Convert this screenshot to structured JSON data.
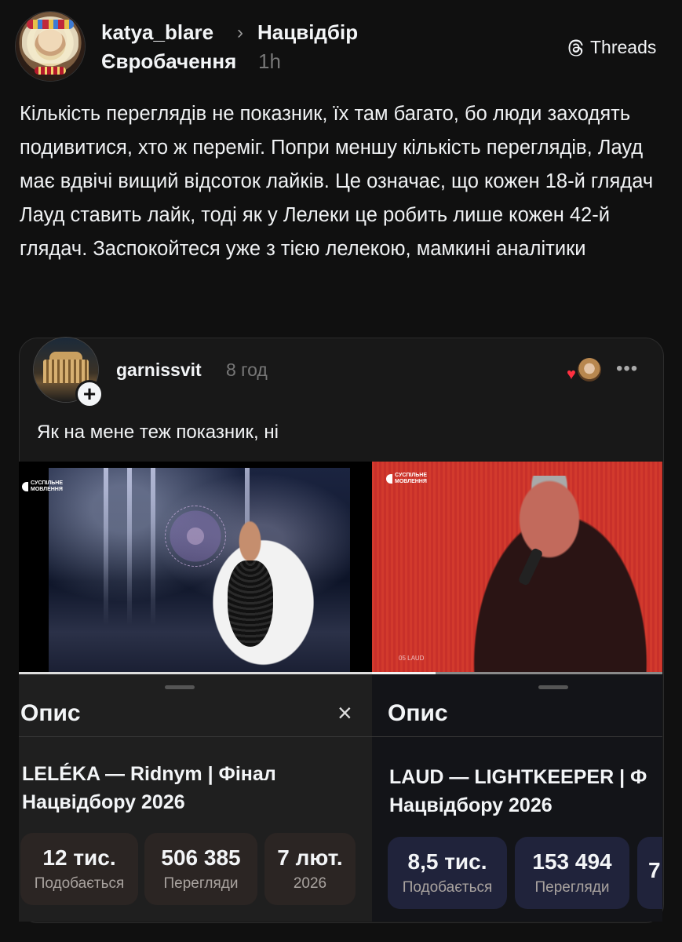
{
  "header": {
    "username": "katya_blare",
    "separator": "›",
    "community_part1": "Нацвідбір",
    "community_part2": "Євробачення",
    "time": "1h",
    "brand": "Threads"
  },
  "post": {
    "text": "Кількість переглядів не показник, їх там багато, бо люди заходять подивитися, хто ж переміг. Попри меншу кількість переглядів, Лауд має вдвічі вищий відсоток лайків. Це означає, що кожен 18-й глядач Лауд ставить лайк, тоді як у Лелеки це робить лише кожен 42-й глядач. Заспокойтеся уже з тією лелекою, мамкині аналітики"
  },
  "quoted": {
    "username": "garnissvit",
    "time": "8 год",
    "plus": "+",
    "more": "•••",
    "heart": "♥",
    "text": "Як на мене теж показник, ні"
  },
  "left_video": {
    "logo_line1": "СУСПІЛЬНЕ",
    "logo_line2": "МОВЛЕННЯ",
    "progress": 1.0,
    "panel_title": "Опис",
    "close": "×",
    "title_line1": "LELÉKA — Ridnym | Фінал",
    "title_line2": "Нацвідбору 2026",
    "stats": [
      {
        "value": "12 тис.",
        "label": "Подобається"
      },
      {
        "value": "506 385",
        "label": "Перегляди"
      },
      {
        "value": "7 лют.",
        "label": "2026"
      }
    ]
  },
  "right_video": {
    "logo_line1": "СУСПІЛЬНЕ",
    "logo_line2": "МОВЛЕННЯ",
    "overlay_label": "05 LAUD",
    "progress": 0.22,
    "panel_title": "Опис",
    "title_line1": "LAUD — LIGHTKEEPER | Ф",
    "title_line2": "Нацвідбору 2026",
    "stats": [
      {
        "value": "8,5 тис.",
        "label": "Подобається"
      },
      {
        "value": "153 494",
        "label": "Перегляди"
      },
      {
        "value": "7",
        "label": ""
      }
    ]
  },
  "colors": {
    "background": "#101010",
    "card": "#181818",
    "stat_left": "#2b2523",
    "stat_right": "#20233b",
    "heart": "#ff3040"
  }
}
